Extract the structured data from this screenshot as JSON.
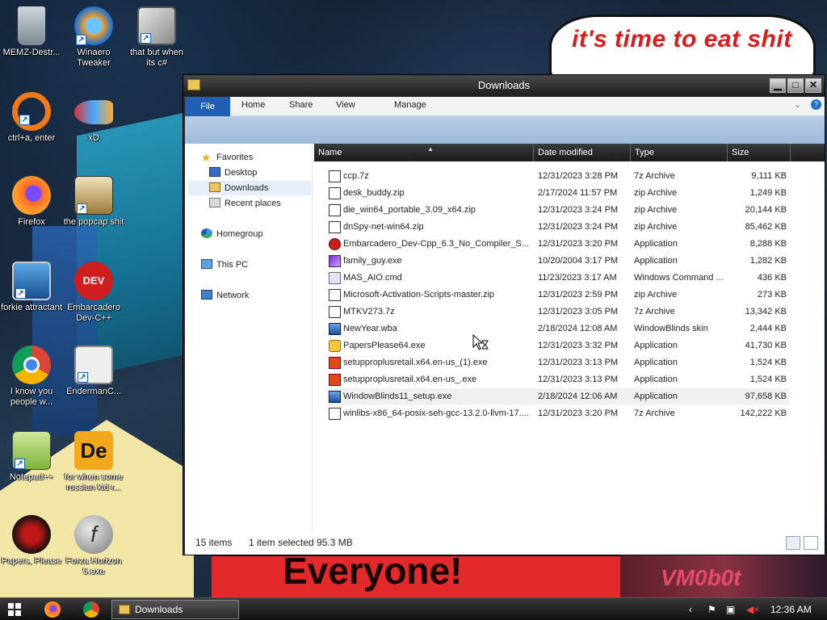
{
  "wallpaper": {
    "speech_text": "it's time to eat shit",
    "poster_text": "Everyone!",
    "watermark": "VM0b0t"
  },
  "desktop_icons": [
    {
      "label": "MEMZ-Destr...",
      "icon": "recycle-bin-icon"
    },
    {
      "label": "Winaero Tweaker",
      "icon": "winaero-icon"
    },
    {
      "label": "that but when its c#",
      "icon": "stacked-windows-icon"
    },
    {
      "label": "ctrl+a, enter",
      "icon": "orange-ring-icon"
    },
    {
      "label": "xD",
      "icon": "fish-icon"
    },
    {
      "label": "Firefox",
      "icon": "firefox-icon"
    },
    {
      "label": "the popcap shit",
      "icon": "popcap-icon"
    },
    {
      "label": "forkie attractant",
      "icon": "monitor-gear-icon"
    },
    {
      "label": "Embarcadero Dev-C++",
      "icon": "devcpp-icon"
    },
    {
      "label": "I know you people w...",
      "icon": "chrome-icon"
    },
    {
      "label": "EndermanC...",
      "icon": "window-app-icon"
    },
    {
      "label": "Notepad++",
      "icon": "notepadpp-icon"
    },
    {
      "label": "for when some russian kid r...",
      "icon": "de-icon"
    },
    {
      "label": "Papers, Please",
      "icon": "papers-please-icon"
    },
    {
      "label": "Forza Horizon 5.exe",
      "icon": "flash-icon"
    }
  ],
  "window": {
    "title": "Downloads",
    "tabs": [
      "File",
      "Home",
      "Share",
      "View",
      "Manage"
    ],
    "nav": {
      "favorites": "Favorites",
      "desktop": "Desktop",
      "downloads": "Downloads",
      "recent": "Recent places",
      "homegroup": "Homegroup",
      "thispc": "This PC",
      "network": "Network"
    },
    "columns": {
      "name": "Name",
      "date": "Date modified",
      "type": "Type",
      "size": "Size"
    },
    "files": [
      {
        "name": "ccp.7z",
        "date": "12/31/2023 3:28 PM",
        "type": "7z Archive",
        "size": "9,111 KB",
        "icon": "zip"
      },
      {
        "name": "desk_buddy.zip",
        "date": "2/17/2024 11:57 PM",
        "type": "zip Archive",
        "size": "1,249 KB",
        "icon": "zip"
      },
      {
        "name": "die_win64_portable_3.09_x64.zip",
        "date": "12/31/2023 3:24 PM",
        "type": "zip Archive",
        "size": "20,144 KB",
        "icon": "zip"
      },
      {
        "name": "dnSpy-net-win64.zip",
        "date": "12/31/2023 3:24 PM",
        "type": "zip Archive",
        "size": "85,462 KB",
        "icon": "zip"
      },
      {
        "name": "Embarcadero_Dev-Cpp_6.3_No_Compiler_S...",
        "date": "12/31/2023 3:20 PM",
        "type": "Application",
        "size": "8,288 KB",
        "icon": "devcpp"
      },
      {
        "name": "family_guy.exe",
        "date": "10/20/2004 3:17 PM",
        "type": "Application",
        "size": "1,282 KB",
        "icon": "purple"
      },
      {
        "name": "MAS_AIO.cmd",
        "date": "11/23/2023 3:17 AM",
        "type": "Windows Command ...",
        "size": "436 KB",
        "icon": "gear"
      },
      {
        "name": "Microsoft-Activation-Scripts-master.zip",
        "date": "12/31/2023 2:59 PM",
        "type": "zip Archive",
        "size": "273 KB",
        "icon": "zip"
      },
      {
        "name": "MTKV273.7z",
        "date": "12/31/2023 3:05 PM",
        "type": "7z Archive",
        "size": "13,342 KB",
        "icon": "zip"
      },
      {
        "name": "NewYear.wba",
        "date": "2/18/2024 12:08 AM",
        "type": "WindowBlinds skin",
        "size": "2,444 KB",
        "icon": "blue"
      },
      {
        "name": "PapersPlease64.exe",
        "date": "12/31/2023 3:32 PM",
        "type": "Application",
        "size": "41,730 KB",
        "icon": "yellow"
      },
      {
        "name": "setupproplusretail.x64.en-us_(1).exe",
        "date": "12/31/2023 3:13 PM",
        "type": "Application",
        "size": "1,524 KB",
        "icon": "office"
      },
      {
        "name": "setupproplusretail.x64.en-us_.exe",
        "date": "12/31/2023 3:13 PM",
        "type": "Application",
        "size": "1,524 KB",
        "icon": "office"
      },
      {
        "name": "WindowBlinds11_setup.exe",
        "date": "2/18/2024 12:06 AM",
        "type": "Application",
        "size": "97,658 KB",
        "icon": "blue"
      },
      {
        "name": "winlibs-x86_64-posix-seh-gcc-13.2.0-llvm-17....",
        "date": "12/31/2023 3:20 PM",
        "type": "7z Archive",
        "size": "142,222 KB",
        "icon": "zip"
      }
    ],
    "status": {
      "count": "15 items",
      "selected": "1 item selected  95.3 MB"
    }
  },
  "taskbar": {
    "task_label": "Downloads",
    "clock": "12:36 AM"
  },
  "colors": {
    "ribbon_accent": "#1f5fb5",
    "titlebar": "#2a2a2a",
    "selected_row": "#f0f0f0"
  }
}
